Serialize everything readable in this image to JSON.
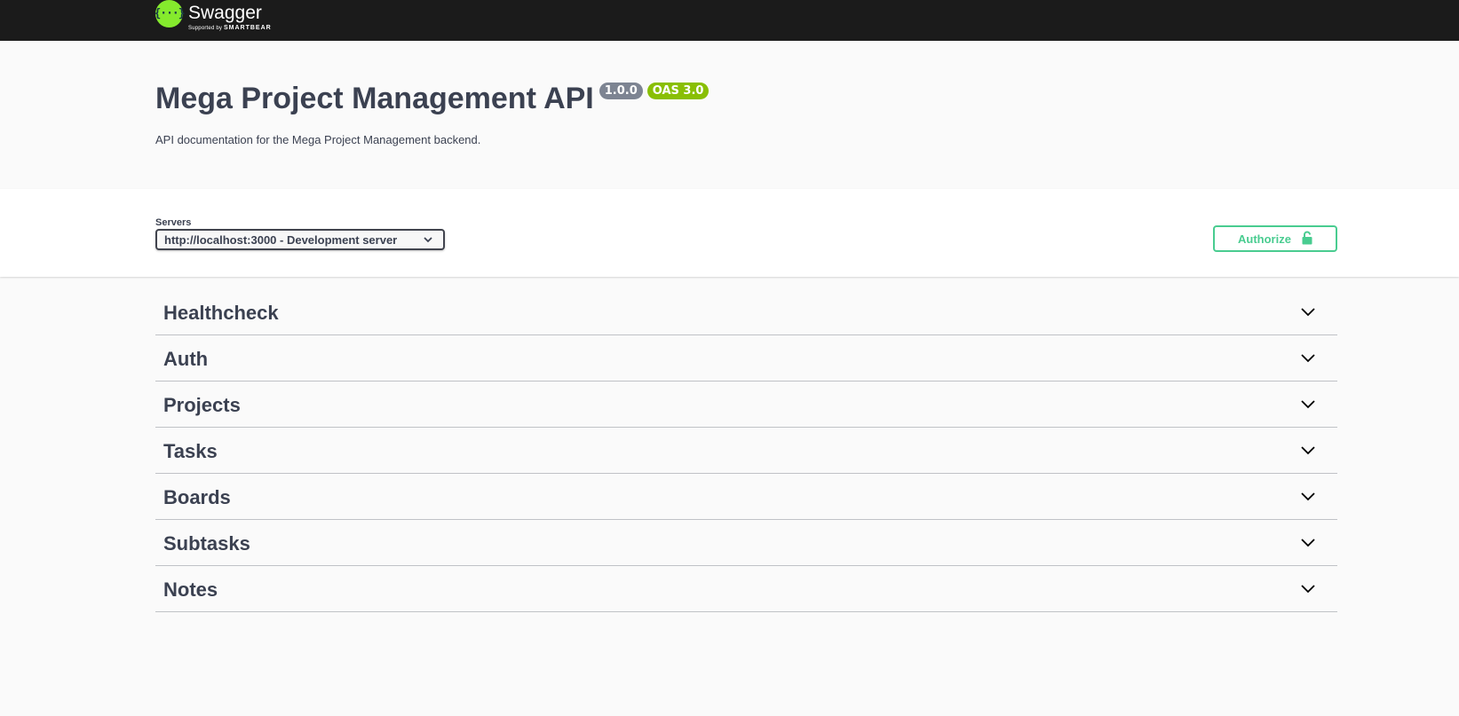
{
  "topbar": {
    "logo_symbol": "{···}",
    "logo_name": "Swagger",
    "logo_sub_prefix": "Supported by",
    "logo_sub_brand": "SMARTBEAR",
    "colors": {
      "background": "#1b1b1b",
      "logo": "#85ea2d"
    }
  },
  "info": {
    "title": "Mega Project Management API",
    "version": "1.0.0",
    "oas": "OAS 3.0",
    "description": "API documentation for the Mega Project Management backend."
  },
  "servers": {
    "label": "Servers",
    "selected": "http://localhost:3000 - Development server"
  },
  "authorize": {
    "label": "Authorize",
    "icon": "lock-icon",
    "color": "#49cc90"
  },
  "tags": [
    {
      "name": "Healthcheck",
      "icon": "chevron-down-icon"
    },
    {
      "name": "Auth",
      "icon": "chevron-down-icon"
    },
    {
      "name": "Projects",
      "icon": "chevron-down-icon"
    },
    {
      "name": "Tasks",
      "icon": "chevron-down-icon"
    },
    {
      "name": "Boards",
      "icon": "chevron-down-icon"
    },
    {
      "name": "Subtasks",
      "icon": "chevron-down-icon"
    },
    {
      "name": "Notes",
      "icon": "chevron-down-icon"
    }
  ]
}
